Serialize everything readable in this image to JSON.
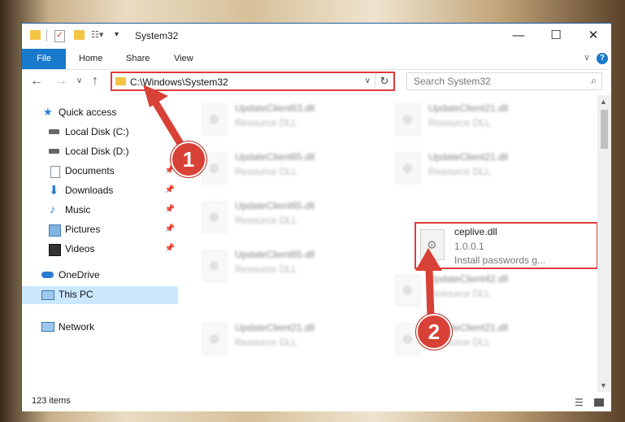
{
  "window": {
    "title": "System32"
  },
  "controls": {
    "minimize": "—",
    "maximize": "☐",
    "close": "✕"
  },
  "ribbon": {
    "tabs": [
      "File",
      "Home",
      "Share",
      "View"
    ],
    "help": "?",
    "expand": "∨"
  },
  "nav": {
    "back": "←",
    "forward": "→",
    "recent": "∨",
    "up": "↑"
  },
  "address": {
    "path": "C:\\Windows\\System32",
    "dropdown": "∨",
    "refresh": "↻"
  },
  "search": {
    "placeholder": "Search System32",
    "icon": "⌕"
  },
  "sidebar": {
    "items": [
      {
        "label": "Quick access",
        "icon": "star-icon"
      },
      {
        "label": "Local Disk (C:)",
        "icon": "drive-icon"
      },
      {
        "label": "Local Disk (D:)",
        "icon": "drive-icon"
      },
      {
        "label": "Documents",
        "icon": "documents-icon"
      },
      {
        "label": "Downloads",
        "icon": "downloads-icon"
      },
      {
        "label": "Music",
        "icon": "music-icon"
      },
      {
        "label": "Pictures",
        "icon": "pictures-icon"
      },
      {
        "label": "Videos",
        "icon": "videos-icon"
      },
      {
        "label": "OneDrive",
        "icon": "cloud-icon"
      },
      {
        "label": "This PC",
        "icon": "computer-icon"
      },
      {
        "label": "Network",
        "icon": "network-icon"
      }
    ]
  },
  "files": [
    {
      "name": "UpdateClient63.dll",
      "desc": "Resource DLL"
    },
    {
      "name": "UpdateClient21.dll",
      "desc": "Resource DLL"
    },
    {
      "name": "UpdateClient65.dll",
      "desc": "Resource DLL"
    },
    {
      "name": "UpdateClient21.dll",
      "desc": "Resource DLL"
    },
    {
      "name": "UpdateClient65.dll",
      "desc": "Resource DLL"
    },
    {
      "name": "ceplive.dll",
      "version": "1.0.0.1",
      "desc": "Install passwords g..."
    },
    {
      "name": "UpdateClient65.dll",
      "desc": "Resource DLL"
    },
    {
      "name": "UpdateClient42.dll",
      "desc": "Resource DLL"
    },
    {
      "name": "UpdateClient21.dll",
      "desc": "Resource DLL"
    },
    {
      "name": "UpdateClient21.dll",
      "desc": "Resource DLL"
    }
  ],
  "status": {
    "items_count": "123 items"
  },
  "annotations": {
    "step1": "1",
    "step2": "2"
  },
  "colors": {
    "accent": "#1979ca",
    "annotation": "#d84136"
  }
}
